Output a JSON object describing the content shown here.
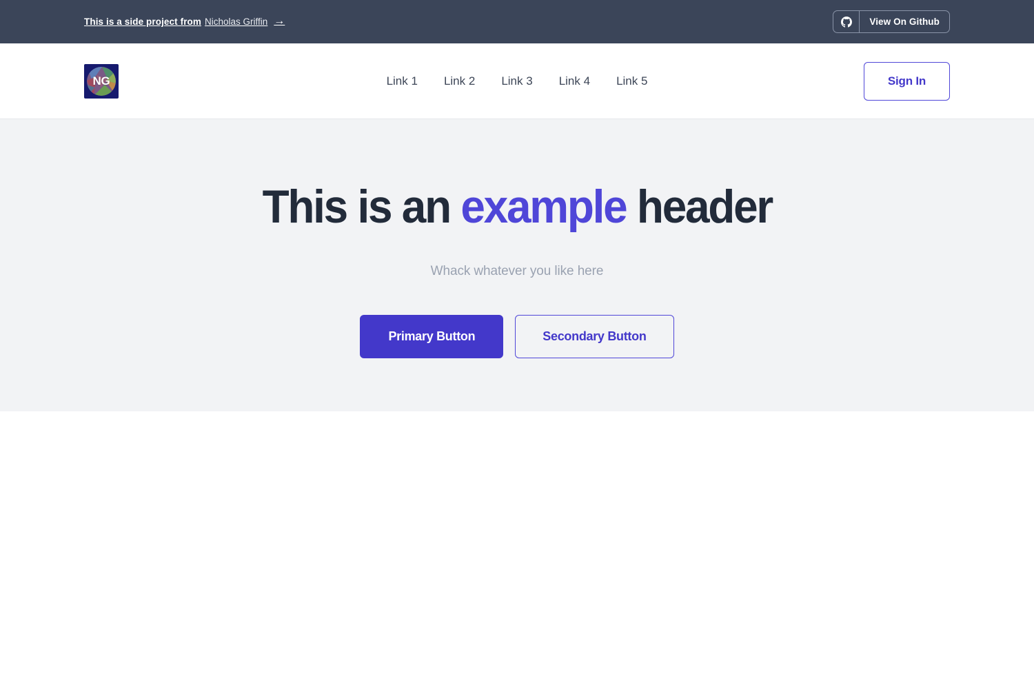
{
  "topbar": {
    "message_strong": "This is a side project from",
    "message_name": "Nicholas Griffin",
    "arrow": "→",
    "github_button": {
      "icon": "github-icon",
      "label": "View On Github"
    }
  },
  "navbar": {
    "logo": {
      "initials": "NG",
      "background_color": "#161a6e"
    },
    "links": [
      {
        "label": "Link 1"
      },
      {
        "label": "Link 2"
      },
      {
        "label": "Link 3"
      },
      {
        "label": "Link 4"
      },
      {
        "label": "Link 5"
      }
    ],
    "signin_label": "Sign In"
  },
  "hero": {
    "title_part1": "This is an ",
    "title_accent": "example",
    "title_part2": " header",
    "subtitle": "Whack whatever you like here",
    "primary_button": "Primary Button",
    "secondary_button": "Secondary Button"
  },
  "colors": {
    "topbar_background": "#3b4559",
    "hero_background": "#f2f3f5",
    "accent_indigo": "#4f46d8",
    "primary_indigo": "#4338ca",
    "heading_navy": "#222b3a",
    "muted_gray": "#9aa2b1",
    "nav_link": "#3d4657"
  }
}
